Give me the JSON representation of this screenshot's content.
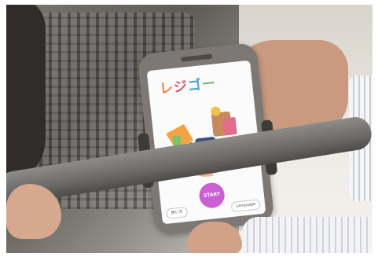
{
  "app": {
    "logo_chars": [
      "レ",
      "ジ",
      "ゴ",
      "ー"
    ],
    "start_label": "START",
    "left_button": "使い方",
    "right_button": "Language"
  },
  "colors": {
    "logo": [
      "#f2823a",
      "#e4547a",
      "#4aa3d9",
      "#6bbf59"
    ],
    "start_button": "#cc5fd6"
  },
  "scene": {
    "icons": [
      "shopping-cart-icon",
      "smartphone-icon",
      "grocery-bag-icon"
    ]
  }
}
